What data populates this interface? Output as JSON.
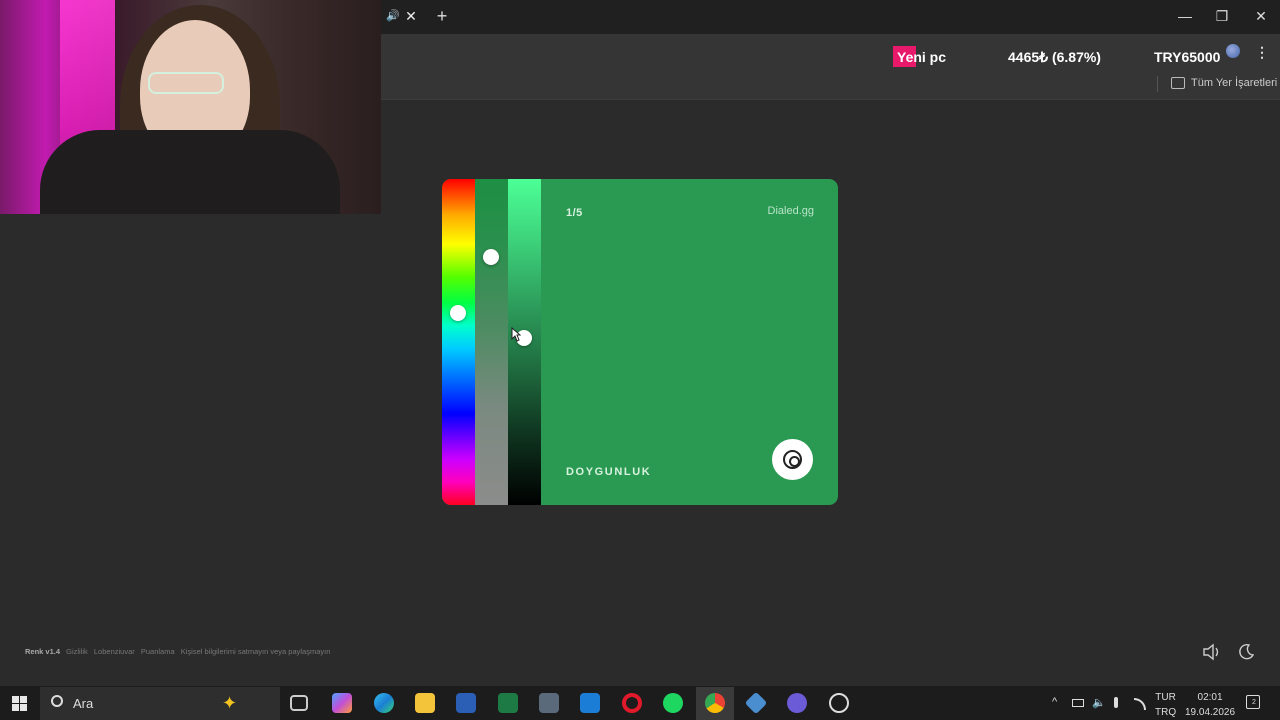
{
  "browser": {
    "new_tab_symbol": "+",
    "close_tab_symbol": "✕",
    "audio_symbol": "🔊",
    "window_controls": [
      "—",
      "❐",
      "✕"
    ],
    "menu_symbol": "⋮",
    "bookmarks_label": "Tüm Yer İşaretleri"
  },
  "overlay": {
    "label": "Yeni pc",
    "amount": "4465₺ (6.87%)",
    "goal": "TRY65000"
  },
  "game": {
    "counter": "1/5",
    "brand": "Dialed.gg",
    "mode_label": "DOYGUNLUK",
    "card_color": "#2a9a52",
    "sliders": {
      "hue_level": 0.41,
      "saturation_level": 0.24,
      "brightness_level": 0.49
    }
  },
  "footer": {
    "version": "Renk v1.4",
    "links": [
      "Gizlilik",
      "Lobenziuvar",
      "Puanlama",
      "Kişisel bilgilerimi satmayın veya paylaşmayın"
    ]
  },
  "taskbar": {
    "search_placeholder": "Ara",
    "lang_top": "TUR",
    "lang_bottom": "TRQ",
    "time": "02:01",
    "date": "19.04.2026",
    "notification_count": "2"
  }
}
